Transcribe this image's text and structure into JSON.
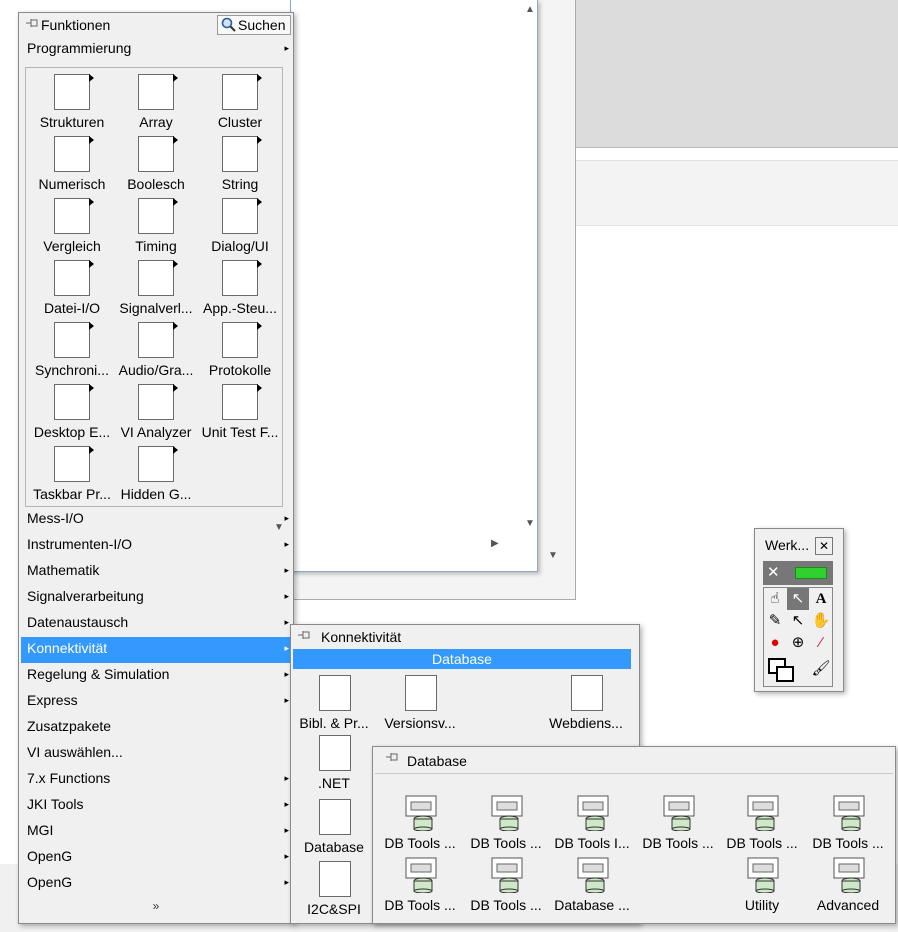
{
  "palette": {
    "title": "Funktionen",
    "search_label": "Suchen",
    "programmierung": "Programmierung",
    "tiles": [
      {
        "label": "Strukturen",
        "icon": "structures-icon"
      },
      {
        "label": "Array",
        "icon": "array-icon"
      },
      {
        "label": "Cluster",
        "icon": "cluster-icon"
      },
      {
        "label": "Numerisch",
        "icon": "numeric-icon"
      },
      {
        "label": "Boolesch",
        "icon": "boolean-icon"
      },
      {
        "label": "String",
        "icon": "string-icon"
      },
      {
        "label": "Vergleich",
        "icon": "comparison-icon"
      },
      {
        "label": "Timing",
        "icon": "timing-icon"
      },
      {
        "label": "Dialog/UI",
        "icon": "dialog-icon"
      },
      {
        "label": "Datei-I/O",
        "icon": "file-io-icon"
      },
      {
        "label": "Signalverl...",
        "icon": "waveform-icon"
      },
      {
        "label": "App.-Steu...",
        "icon": "app-control-icon"
      },
      {
        "label": "Synchroni...",
        "icon": "synchronization-icon"
      },
      {
        "label": "Audio/Gra...",
        "icon": "audio-icon"
      },
      {
        "label": "Protokolle",
        "icon": "report-icon"
      },
      {
        "label": "Desktop E...",
        "icon": "desktop-execution-icon"
      },
      {
        "label": "VI Analyzer",
        "icon": "vi-analyzer-icon"
      },
      {
        "label": "Unit Test F...",
        "icon": "unit-test-icon"
      },
      {
        "label": "Taskbar Pr...",
        "icon": "taskbar-icon"
      },
      {
        "label": "Hidden G...",
        "icon": "hidden-gem-icon"
      }
    ],
    "menu": [
      "Mess-I/O",
      "Instrumenten-I/O",
      "Mathematik",
      "Signalverarbeitung",
      "Datenaustausch",
      "Konnektivität",
      "Regelung & Simulation",
      "Express",
      "Zusatzpakete",
      "VI auswählen...",
      "7.x Functions",
      "JKI Tools",
      "MGI",
      "OpenG",
      "OpenG"
    ],
    "selected_menu": "Konnektivität",
    "scroll_down": "»"
  },
  "konnektivitaet": {
    "title": "Konnektivität",
    "bar": "Database",
    "tiles": [
      {
        "label": "Bibl. & Pr...",
        "icon": "library-icon"
      },
      {
        "label": "Versionsv...",
        "icon": "source-control-icon"
      },
      {
        "label": "Webdiens...",
        "icon": "web-services-icon"
      },
      {
        "label": ".NET",
        "icon": "dotnet-icon"
      },
      {
        "label": "Database",
        "icon": "database-icon"
      },
      {
        "label": "I2C&SPI",
        "icon": "i2c-spi-icon"
      }
    ]
  },
  "database": {
    "title": "Database",
    "tiles": [
      {
        "label": "DB Tools ...",
        "icon": "db-open-icon"
      },
      {
        "label": "DB Tools ...",
        "icon": "db-close-icon"
      },
      {
        "label": "DB Tools I...",
        "icon": "db-insert-icon"
      },
      {
        "label": "DB Tools ...",
        "icon": "db-select-icon"
      },
      {
        "label": "DB Tools ...",
        "icon": "db-update-icon"
      },
      {
        "label": "DB Tools ...",
        "icon": "db-delete-icon"
      },
      {
        "label": "DB Tools ...",
        "icon": "db-create-table-icon"
      },
      {
        "label": "DB Tools ...",
        "icon": "db-drop-table-icon"
      },
      {
        "label": "Database ...",
        "icon": "db-variant-icon"
      },
      {
        "label": "Utility",
        "icon": "db-utility-icon"
      },
      {
        "label": "Advanced",
        "icon": "db-advanced-icon"
      }
    ]
  },
  "werkzeuge": {
    "title": "Werk...",
    "close": "✕"
  }
}
